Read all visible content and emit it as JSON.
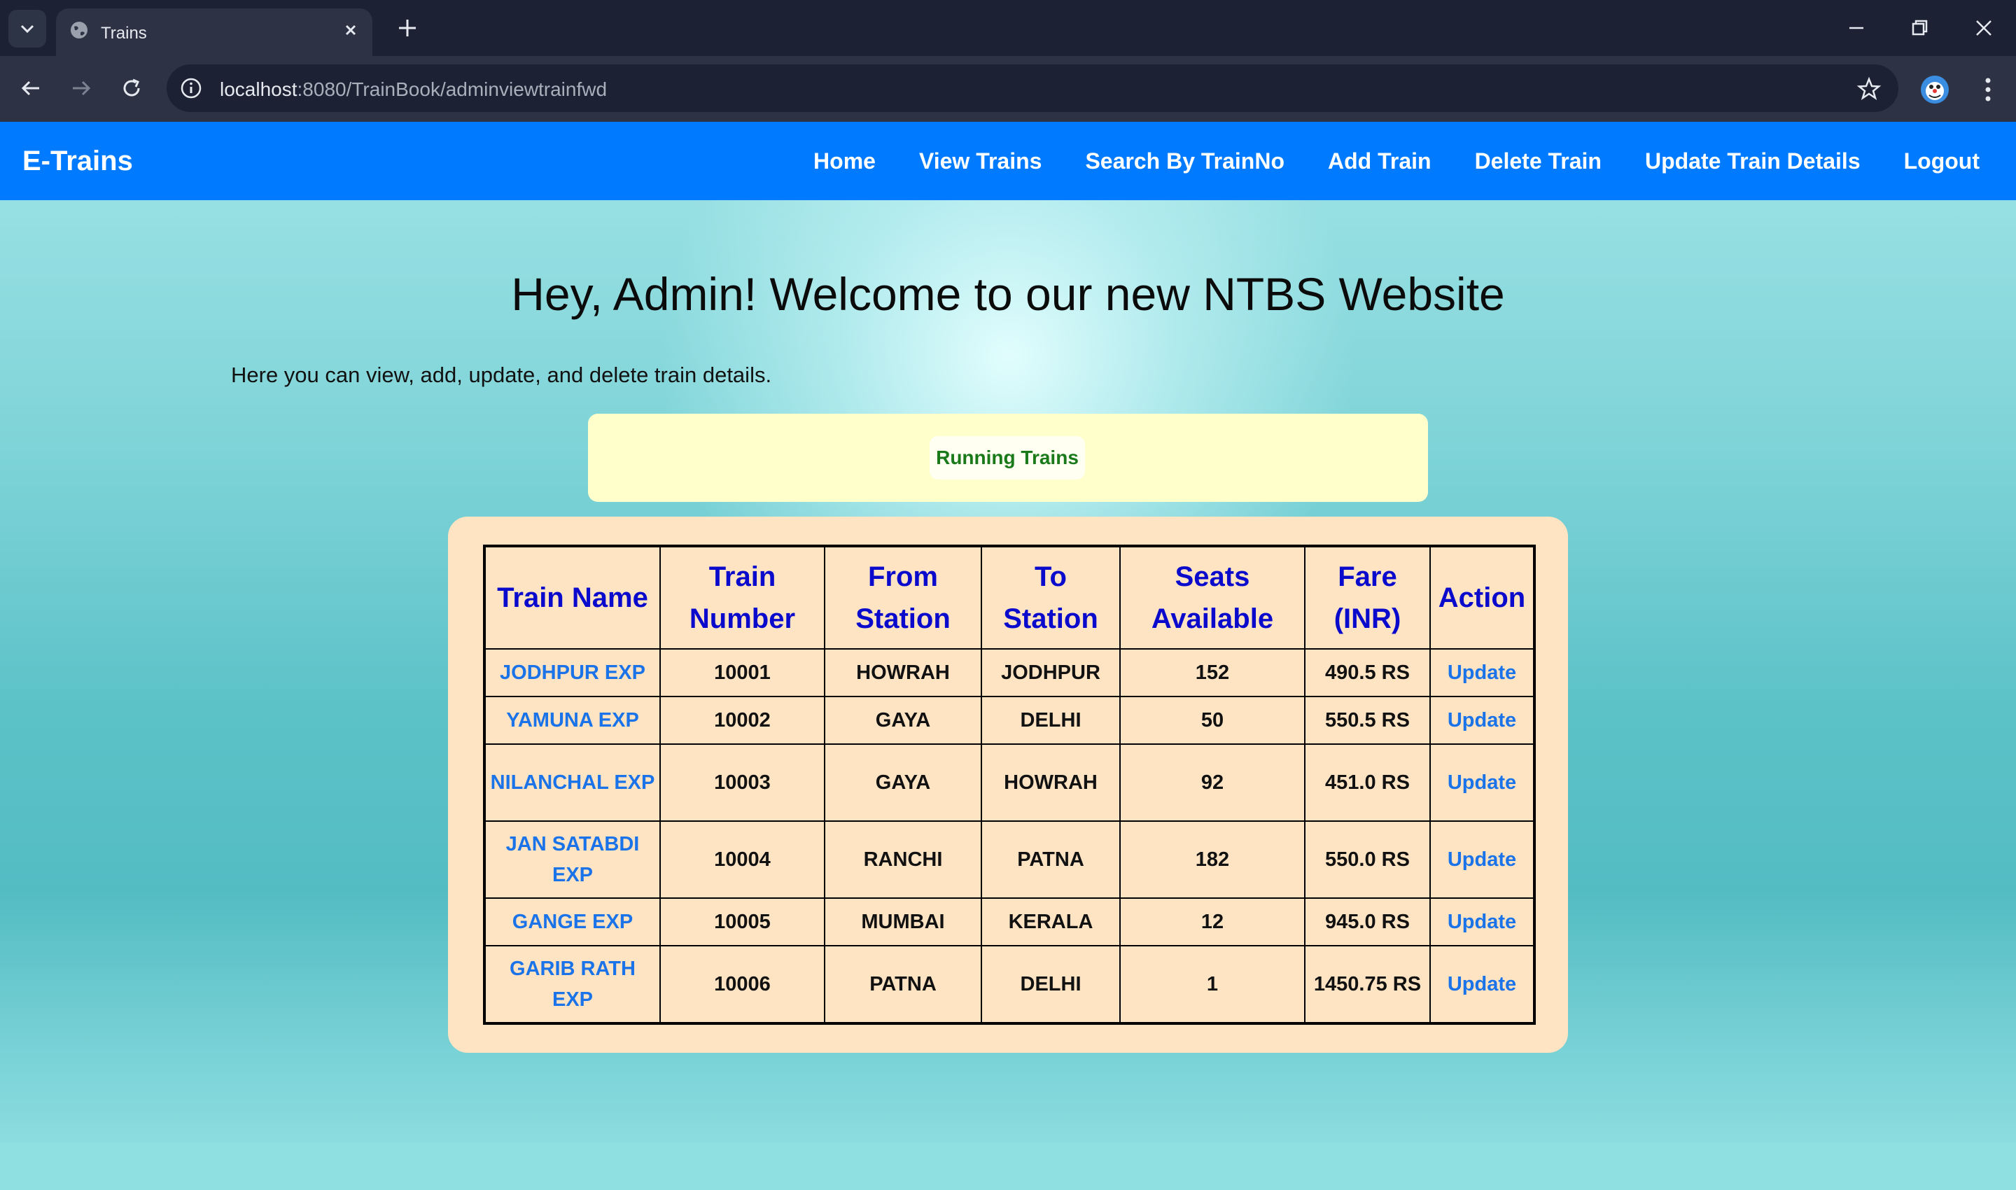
{
  "browser": {
    "tab_title": "Trains",
    "url_host": "localhost",
    "url_rest": ":8080/TrainBook/adminviewtrainfwd"
  },
  "navbar": {
    "brand": "E-Trains",
    "links": [
      "Home",
      "View Trains",
      "Search By TrainNo",
      "Add Train",
      "Delete Train",
      "Update Train Details",
      "Logout"
    ]
  },
  "main": {
    "welcome": "Hey, Admin! Welcome to our new NTBS Website",
    "intro": "Here you can view, add, update, and delete train details.",
    "running_label": "Running Trains"
  },
  "table": {
    "headers": [
      [
        "Train",
        "Name"
      ],
      [
        "Train",
        "Number"
      ],
      [
        "From",
        "Station"
      ],
      [
        "To",
        "Station"
      ],
      [
        "Seats",
        "Available"
      ],
      [
        "Fare",
        "(INR)"
      ],
      [
        "Action",
        ""
      ]
    ],
    "header_single": [
      "Train Name",
      "",
      "",
      "",
      "",
      "",
      "Action"
    ],
    "rows": [
      {
        "name": "JODHPUR EXP",
        "number": "10001",
        "from": "HOWRAH",
        "to": "JODHPUR",
        "seats": "152",
        "fare": "490.5 RS",
        "action": "Update"
      },
      {
        "name": "YAMUNA EXP",
        "number": "10002",
        "from": "GAYA",
        "to": "DELHI",
        "seats": "50",
        "fare": "550.5 RS",
        "action": "Update"
      },
      {
        "name": "NILANCHAL EXP",
        "number": "10003",
        "from": "GAYA",
        "to": "HOWRAH",
        "seats": "92",
        "fare": "451.0 RS",
        "action": "Update"
      },
      {
        "name": "JAN SATABDI EXP",
        "number": "10004",
        "from": "RANCHI",
        "to": "PATNA",
        "seats": "182",
        "fare": "550.0 RS",
        "action": "Update"
      },
      {
        "name": "GANGE EXP",
        "number": "10005",
        "from": "MUMBAI",
        "to": "KERALA",
        "seats": "12",
        "fare": "945.0 RS",
        "action": "Update"
      },
      {
        "name": "GARIB RATH EXP",
        "number": "10006",
        "from": "PATNA",
        "to": "DELHI",
        "seats": "1",
        "fare": "1450.75 RS",
        "action": "Update"
      }
    ]
  }
}
